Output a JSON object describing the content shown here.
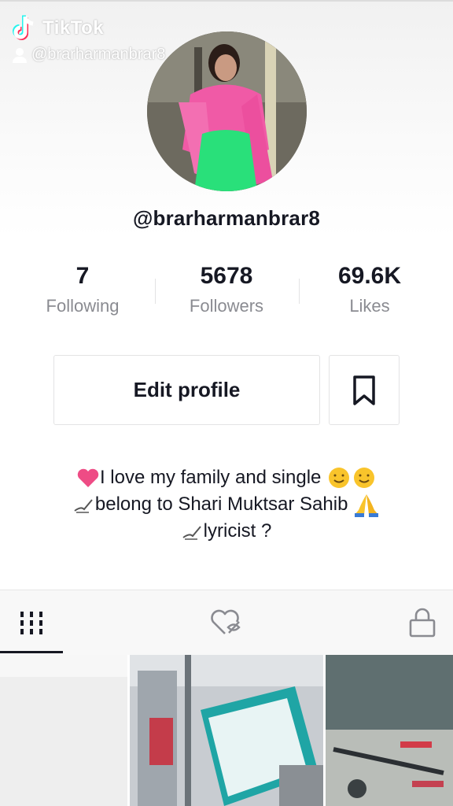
{
  "watermark": {
    "brand": "TikTok",
    "handle": "@brarharmanbrar8",
    "logo_icon": "tiktok-logo-icon",
    "user_icon": "user-icon"
  },
  "profile": {
    "username": "@brarharmanbrar8",
    "avatar_icon": "profile-photo"
  },
  "stats": [
    {
      "value": "7",
      "label": "Following"
    },
    {
      "value": "5678",
      "label": "Followers"
    },
    {
      "value": "69.6K",
      "label": "Likes"
    }
  ],
  "actions": {
    "edit_profile_label": "Edit profile",
    "bookmark_icon": "bookmark-icon"
  },
  "bio": {
    "line1": "I love my family and  single",
    "line2": "belong to Shari Muktsar Sahib",
    "line3": "lyricist ?"
  },
  "tabs": [
    {
      "icon": "grid-icon",
      "active": true
    },
    {
      "icon": "liked-hidden-icon",
      "active": false
    },
    {
      "icon": "lock-icon",
      "active": false
    }
  ],
  "colors": {
    "pink": "#ee4c85",
    "accent_dark": "#161823",
    "muted": "#8a8b91",
    "border": "#e3e3e4"
  }
}
